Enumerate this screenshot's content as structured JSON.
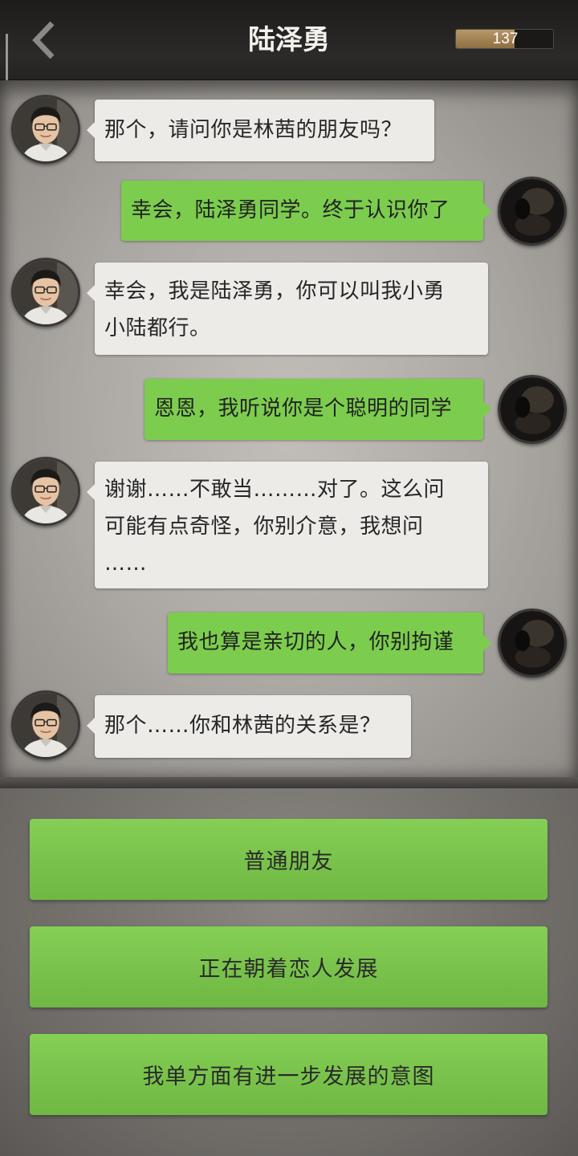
{
  "header": {
    "back_icon": "chevron-left-icon",
    "title": "陆泽勇",
    "meter_value": "137",
    "meter_fill_fraction": 0.6
  },
  "chat": {
    "messages": [
      {
        "side": "in",
        "text": "那个，请问你是林茜的朋友吗？"
      },
      {
        "side": "out",
        "text": "幸会，陆泽勇同学。终于认识你了"
      },
      {
        "side": "in",
        "text": "幸会，我是陆泽勇，你可以叫我小勇\n小陆都行。"
      },
      {
        "side": "out",
        "text": "恩恩，我听说你是个聪明的同学"
      },
      {
        "side": "in",
        "text": "谢谢……不敢当………对了。这么问\n可能有点奇怪，你别介意，我想问\n……"
      },
      {
        "side": "out",
        "text": "我也算是亲切的人，你别拘谨"
      },
      {
        "side": "in",
        "text": "那个……你和林茜的关系是？"
      }
    ]
  },
  "choices": [
    {
      "label": "普通朋友"
    },
    {
      "label": "正在朝着恋人发展"
    },
    {
      "label": "我单方面有进一步发展的意图"
    }
  ],
  "colors": {
    "incoming_bubble": "#ecebe8",
    "outgoing_bubble": "#7ccd4e",
    "choice_button": "#7ac44c"
  }
}
